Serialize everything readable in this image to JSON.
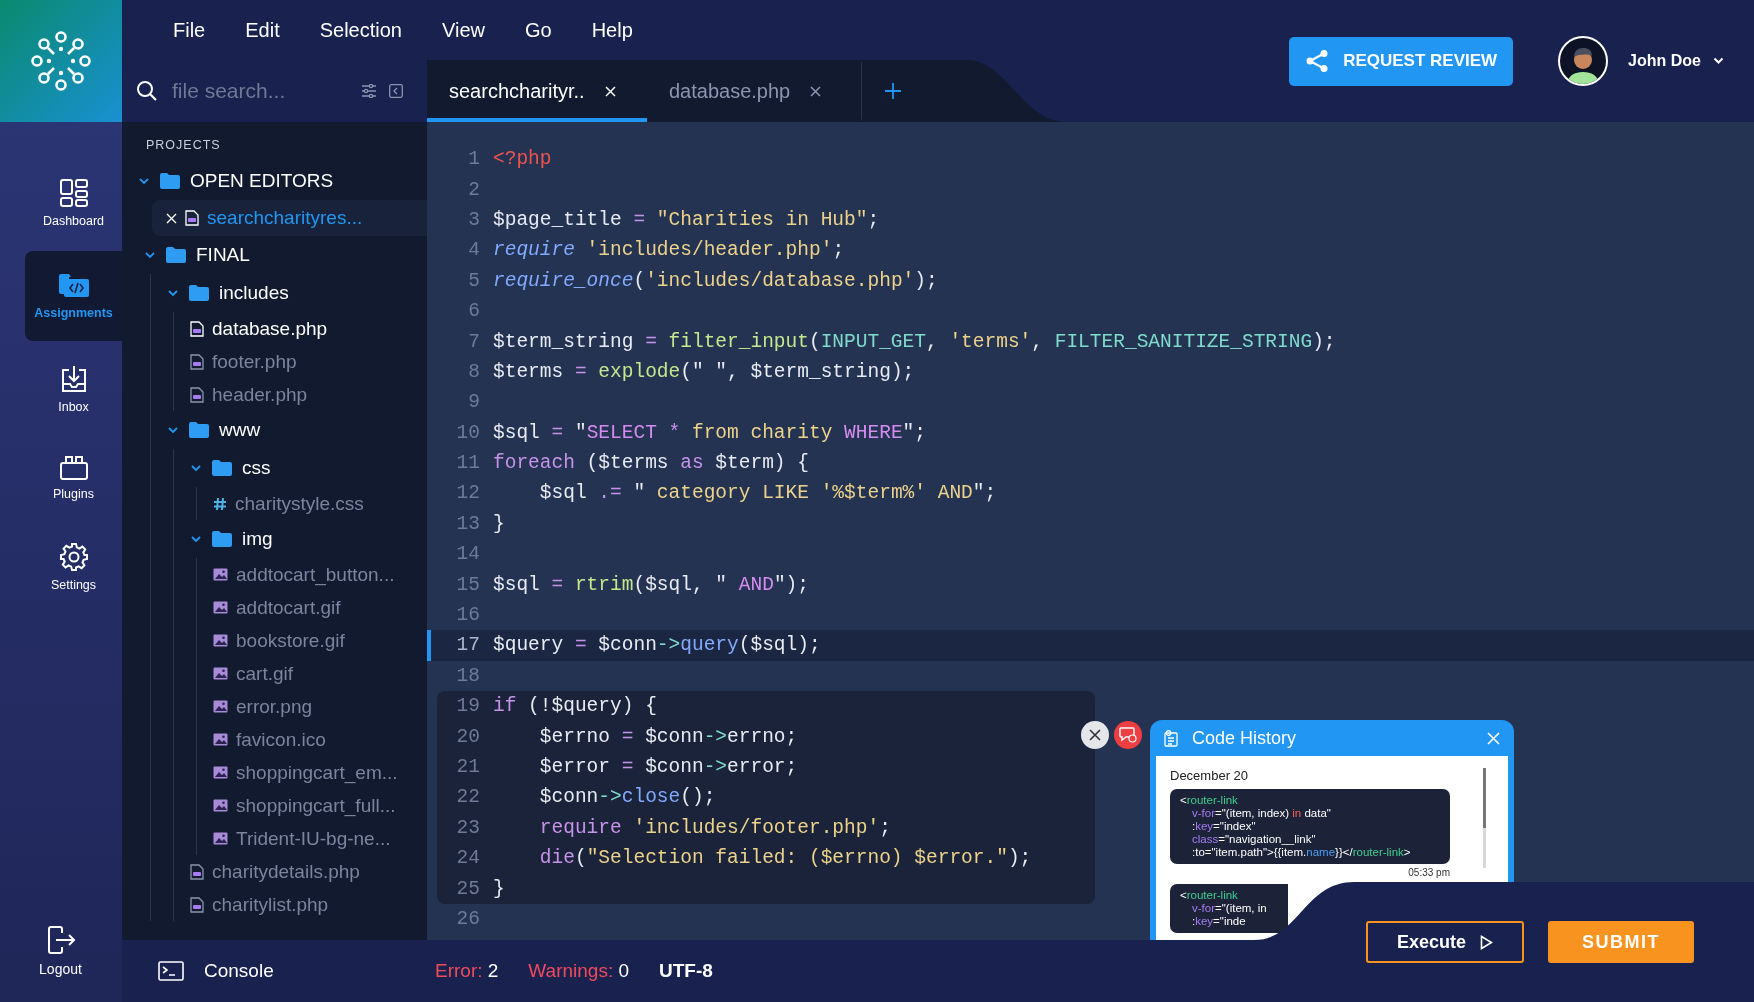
{
  "nav": {
    "items": [
      {
        "label": "Dashboard",
        "selected": false
      },
      {
        "label": "Assignments",
        "selected": true
      },
      {
        "label": "Inbox",
        "selected": false
      },
      {
        "label": "Plugins",
        "selected": false
      },
      {
        "label": "Settings",
        "selected": false
      }
    ],
    "logout": "Logout"
  },
  "menu": [
    "File",
    "Edit",
    "Selection",
    "View",
    "Go",
    "Help"
  ],
  "search": {
    "placeholder": "file search..."
  },
  "tabs": [
    {
      "label": "searchcharityr..",
      "selected": true
    },
    {
      "label": "database.php",
      "selected": false
    }
  ],
  "header": {
    "review_button": "REQUEST REVIEW",
    "user": "John Doe"
  },
  "explorer": {
    "heading": "PROJECTS",
    "open_editors": {
      "label": "OPEN EDITORS",
      "expanded": true,
      "files": [
        {
          "label": "searchcharityres...",
          "selected": true
        }
      ]
    },
    "tree": [
      {
        "label": "FINAL",
        "kind": "folder",
        "expanded": true,
        "children": [
          {
            "label": "includes",
            "kind": "folder",
            "expanded": true,
            "children": [
              {
                "label": "database.php",
                "kind": "php",
                "active": true
              },
              {
                "label": "footer.php",
                "kind": "php",
                "active": false
              },
              {
                "label": "header.php",
                "kind": "php",
                "active": false
              }
            ]
          },
          {
            "label": "www",
            "kind": "folder",
            "expanded": true,
            "children": [
              {
                "label": "css",
                "kind": "folder",
                "expanded": true,
                "children": [
                  {
                    "label": "charitystyle.css",
                    "kind": "css",
                    "active": false
                  }
                ]
              },
              {
                "label": "img",
                "kind": "folder",
                "expanded": true,
                "children": [
                  {
                    "label": "addtocart_button...",
                    "kind": "image",
                    "active": false
                  },
                  {
                    "label": "addtocart.gif",
                    "kind": "image",
                    "active": false
                  },
                  {
                    "label": "bookstore.gif",
                    "kind": "image",
                    "active": false
                  },
                  {
                    "label": "cart.gif",
                    "kind": "image",
                    "active": false
                  },
                  {
                    "label": "error.png",
                    "kind": "image",
                    "active": false
                  },
                  {
                    "label": "favicon.ico",
                    "kind": "image",
                    "active": false
                  },
                  {
                    "label": "shoppingcart_em...",
                    "kind": "image",
                    "active": false
                  },
                  {
                    "label": "shoppingcart_full...",
                    "kind": "image",
                    "active": false
                  },
                  {
                    "label": "Trident-IU-bg-ne...",
                    "kind": "image",
                    "active": false
                  }
                ]
              },
              {
                "label": "charitydetails.php",
                "kind": "php",
                "active": false
              },
              {
                "label": "charitylist.php",
                "kind": "php",
                "active": false
              }
            ]
          }
        ]
      }
    ]
  },
  "editor": {
    "lines": [
      {
        "number": "1",
        "current": false,
        "highlighted": false,
        "tokens": [
          {
            "text": "<?php",
            "kind": "tag"
          }
        ]
      },
      {
        "number": "2",
        "current": false,
        "highlighted": false
      },
      {
        "number": "3",
        "current": false,
        "highlighted": false,
        "tokens": [
          {
            "text": "$page_title ",
            "kind": "var"
          },
          {
            "text": "=",
            "kind": "op"
          },
          {
            "text": " \"Charities in Hub\"",
            "kind": "str"
          },
          {
            "text": ";",
            "kind": "plain"
          }
        ]
      },
      {
        "number": "4",
        "current": false,
        "highlighted": false,
        "tokens": [
          {
            "text": "require",
            "kind": "italic"
          },
          {
            "text": " 'includes/header.php'",
            "kind": "str"
          },
          {
            "text": ";",
            "kind": "plain"
          }
        ]
      },
      {
        "number": "5",
        "current": false,
        "highlighted": false,
        "tokens": [
          {
            "text": "require_once",
            "kind": "italic"
          },
          {
            "text": "(",
            "kind": "plain"
          },
          {
            "text": "'includes/database.php'",
            "kind": "str"
          },
          {
            "text": ");",
            "kind": "plain"
          }
        ]
      },
      {
        "number": "6",
        "current": false,
        "highlighted": false
      },
      {
        "number": "7",
        "current": false,
        "highlighted": false,
        "tokens": [
          {
            "text": "$term_string ",
            "kind": "var"
          },
          {
            "text": "=",
            "kind": "op"
          },
          {
            "text": " filter_input",
            "kind": "func"
          },
          {
            "text": "(",
            "kind": "plain"
          },
          {
            "text": "INPUT_GET",
            "kind": "const"
          },
          {
            "text": ", ",
            "kind": "plain"
          },
          {
            "text": "'terms'",
            "kind": "str"
          },
          {
            "text": ", ",
            "kind": "plain"
          },
          {
            "text": "FILTER_SANITIZE_STRING",
            "kind": "const"
          },
          {
            "text": ");",
            "kind": "plain"
          }
        ]
      },
      {
        "number": "8",
        "current": false,
        "highlighted": false,
        "tokens": [
          {
            "text": "$terms ",
            "kind": "var"
          },
          {
            "text": "=",
            "kind": "op"
          },
          {
            "text": " explode",
            "kind": "func"
          },
          {
            "text": "(\" \", $term_string);",
            "kind": "plain"
          }
        ]
      },
      {
        "number": "9",
        "current": false,
        "highlighted": false
      },
      {
        "number": "10",
        "current": false,
        "highlighted": false,
        "tokens": [
          {
            "text": "$sql ",
            "kind": "var"
          },
          {
            "text": "=",
            "kind": "op"
          },
          {
            "text": " \"",
            "kind": "plain"
          },
          {
            "text": "SELECT",
            "kind": "sql"
          },
          {
            "text": " *",
            "kind": "op"
          },
          {
            "text": " from charity ",
            "kind": "str"
          },
          {
            "text": "WHERE",
            "kind": "sql"
          },
          {
            "text": "\";",
            "kind": "plain"
          }
        ]
      },
      {
        "number": "11",
        "current": false,
        "highlighted": false,
        "tokens": [
          {
            "text": "foreach",
            "kind": "kw"
          },
          {
            "text": " ($terms ",
            "kind": "plain"
          },
          {
            "text": "as",
            "kind": "kw"
          },
          {
            "text": " $term) {",
            "kind": "plain"
          }
        ]
      },
      {
        "number": "12",
        "current": false,
        "highlighted": false,
        "tokens": [
          {
            "text": "    $sql ",
            "kind": "plain"
          },
          {
            "text": ".=",
            "kind": "op"
          },
          {
            "text": " \" ",
            "kind": "plain"
          },
          {
            "text": "category LIKE '%$term%' AND",
            "kind": "str"
          },
          {
            "text": "\";",
            "kind": "plain"
          }
        ]
      },
      {
        "number": "13",
        "current": false,
        "highlighted": false,
        "tokens": [
          {
            "text": "}",
            "kind": "plain"
          }
        ]
      },
      {
        "number": "14",
        "current": false,
        "highlighted": false
      },
      {
        "number": "15",
        "current": false,
        "highlighted": false,
        "tokens": [
          {
            "text": "$sql ",
            "kind": "var"
          },
          {
            "text": "=",
            "kind": "op"
          },
          {
            "text": " rtrim",
            "kind": "func"
          },
          {
            "text": "($sql, \" ",
            "kind": "plain"
          },
          {
            "text": "AND",
            "kind": "sql"
          },
          {
            "text": "\");",
            "kind": "plain"
          }
        ]
      },
      {
        "number": "16",
        "current": false,
        "highlighted": false
      },
      {
        "number": "17",
        "current": true,
        "highlighted": false,
        "tokens": [
          {
            "text": "$query ",
            "kind": "var"
          },
          {
            "text": "=",
            "kind": "op"
          },
          {
            "text": " $conn",
            "kind": "plain"
          },
          {
            "text": "->",
            "kind": "const"
          },
          {
            "text": "query",
            "kind": "method"
          },
          {
            "text": "($sql);",
            "kind": "plain"
          }
        ]
      },
      {
        "number": "18",
        "current": false,
        "highlighted": false
      },
      {
        "number": "19",
        "current": false,
        "highlighted": true,
        "tokens": [
          {
            "text": "if",
            "kind": "kw"
          },
          {
            "text": " (!$query) {",
            "kind": "plain"
          }
        ]
      },
      {
        "number": "20",
        "current": false,
        "highlighted": true,
        "tokens": [
          {
            "text": "    $errno ",
            "kind": "plain"
          },
          {
            "text": "=",
            "kind": "op"
          },
          {
            "text": " $conn",
            "kind": "plain"
          },
          {
            "text": "->",
            "kind": "const"
          },
          {
            "text": "errno;",
            "kind": "plain"
          }
        ]
      },
      {
        "number": "21",
        "current": false,
        "highlighted": true,
        "tokens": [
          {
            "text": "    $error ",
            "kind": "plain"
          },
          {
            "text": "=",
            "kind": "op"
          },
          {
            "text": " $conn",
            "kind": "plain"
          },
          {
            "text": "->",
            "kind": "const"
          },
          {
            "text": "error;",
            "kind": "plain"
          }
        ]
      },
      {
        "number": "22",
        "current": false,
        "highlighted": true,
        "tokens": [
          {
            "text": "    $conn",
            "kind": "plain"
          },
          {
            "text": "->",
            "kind": "const"
          },
          {
            "text": "close",
            "kind": "method"
          },
          {
            "text": "();",
            "kind": "plain"
          }
        ]
      },
      {
        "number": "23",
        "current": false,
        "highlighted": true,
        "tokens": [
          {
            "text": "    require",
            "kind": "kw"
          },
          {
            "text": " 'includes/footer.php'",
            "kind": "str"
          },
          {
            "text": ";",
            "kind": "plain"
          }
        ]
      },
      {
        "number": "24",
        "current": false,
        "highlighted": true,
        "tokens": [
          {
            "text": "    die",
            "kind": "kw"
          },
          {
            "text": "(",
            "kind": "plain"
          },
          {
            "text": "\"Selection failed: ($errno) $error.\"",
            "kind": "str"
          },
          {
            "text": ");",
            "kind": "plain"
          }
        ]
      },
      {
        "number": "25",
        "current": false,
        "highlighted": true,
        "tokens": [
          {
            "text": "}",
            "kind": "plain"
          }
        ]
      },
      {
        "number": "26",
        "current": false,
        "highlighted": false
      }
    ]
  },
  "code_history": {
    "title": "Code History",
    "date": "December 20",
    "entries": [
      {
        "time": "05:33 pm",
        "lines": [
          [
            {
              "text": "<",
              "kind": "plain"
            },
            {
              "text": "router-link",
              "kind": "tag"
            }
          ],
          [
            {
              "text": "v-for",
              "kind": "attr"
            },
            {
              "text": "=\"(item, index) ",
              "kind": "plain"
            },
            {
              "text": "in",
              "kind": "kw"
            },
            {
              "text": " data\"",
              "kind": "plain"
            }
          ],
          [
            {
              "text": ":",
              "kind": "plain"
            },
            {
              "text": "key",
              "kind": "attr"
            },
            {
              "text": "=\"index\"",
              "kind": "plain"
            }
          ],
          [
            {
              "text": "class",
              "kind": "attr"
            },
            {
              "text": "=\"navigation__link\"",
              "kind": "plain"
            }
          ],
          [
            {
              "text": ":to=\"item.path\">{{item.",
              "kind": "plain"
            },
            {
              "text": "name",
              "kind": "prop"
            },
            {
              "text": "}}</",
              "kind": "plain"
            },
            {
              "text": "router-link",
              "kind": "tag"
            },
            {
              "text": ">",
              "kind": "plain"
            }
          ]
        ]
      },
      {
        "lines": [
          [
            {
              "text": "<",
              "kind": "plain"
            },
            {
              "text": "router-link",
              "kind": "tag"
            }
          ],
          [
            {
              "text": "v-for",
              "kind": "attr"
            },
            {
              "text": "=\"(item, in",
              "kind": "plain"
            }
          ],
          [
            {
              "text": ":",
              "kind": "plain"
            },
            {
              "text": "key",
              "kind": "attr"
            },
            {
              "text": "=\"inde",
              "kind": "plain"
            }
          ]
        ]
      }
    ]
  },
  "status_bar": {
    "console": "Console",
    "errors": {
      "label": "Error:",
      "count": "2"
    },
    "warnings": {
      "label": "Warnings:",
      "count": "0"
    },
    "encoding": "UTF-8"
  },
  "actions": {
    "execute": "Execute",
    "submit": "SUBMIT"
  }
}
